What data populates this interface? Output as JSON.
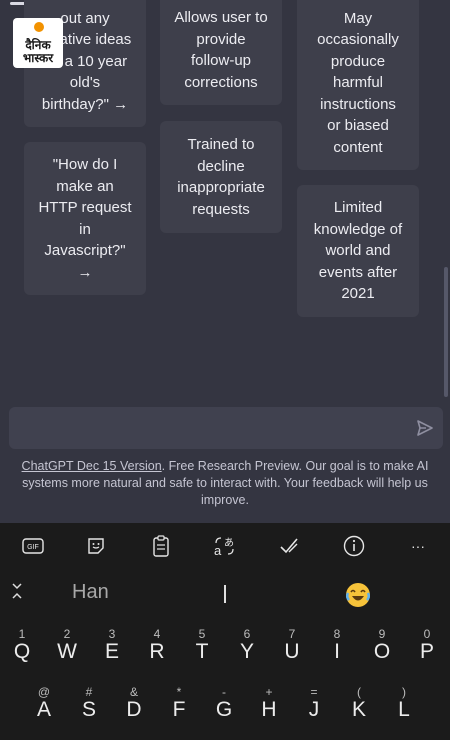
{
  "logo": {
    "line1": "दैनिक",
    "line2": "भास्कर"
  },
  "cards": {
    "c1": "out any\ncreative ideas\nfor a 10 year\nold's\nbirthday?\" →",
    "c2": "Allows user to\nprovide\nfollow-up\ncorrections",
    "c3": "May\noccasionally\nproduce\nharmful\ninstructions\nor biased\ncontent",
    "c4": "\"How do I\nmake an\nHTTP request\nin\nJavascript?\"\n→",
    "c5": "Trained to\ndecline\ninappropriate\nrequests",
    "c6": "Limited\nknowledge of\nworld and\nevents after\n2021"
  },
  "input": {
    "value": ""
  },
  "footer": {
    "link": "ChatGPT Dec 15 Version",
    "text": ". Free Research Preview. Our goal is to make AI systems more natural and safe to interact with. Your feedback will help us improve."
  },
  "keyboard": {
    "toolbar": {
      "gif": "GIF",
      "more": "···"
    },
    "suggestion": "Han",
    "row1": [
      {
        "hint": "1",
        "key": "Q"
      },
      {
        "hint": "2",
        "key": "W"
      },
      {
        "hint": "3",
        "key": "E"
      },
      {
        "hint": "4",
        "key": "R"
      },
      {
        "hint": "5",
        "key": "T"
      },
      {
        "hint": "6",
        "key": "Y"
      },
      {
        "hint": "7",
        "key": "U"
      },
      {
        "hint": "8",
        "key": "I"
      },
      {
        "hint": "9",
        "key": "O"
      },
      {
        "hint": "0",
        "key": "P"
      }
    ],
    "row2": [
      {
        "hint": "@",
        "key": "A"
      },
      {
        "hint": "#",
        "key": "S"
      },
      {
        "hint": "&",
        "key": "D"
      },
      {
        "hint": "*",
        "key": "F"
      },
      {
        "hint": "-",
        "key": "G"
      },
      {
        "hint": "+",
        "key": "H"
      },
      {
        "hint": "=",
        "key": "J"
      },
      {
        "hint": "(",
        "key": "K"
      },
      {
        "hint": ")",
        "key": "L"
      }
    ]
  },
  "colors": {
    "background": "#343541",
    "card": "#3e3f4b",
    "input": "#40414f",
    "keyboard": "#1b1b1b"
  }
}
